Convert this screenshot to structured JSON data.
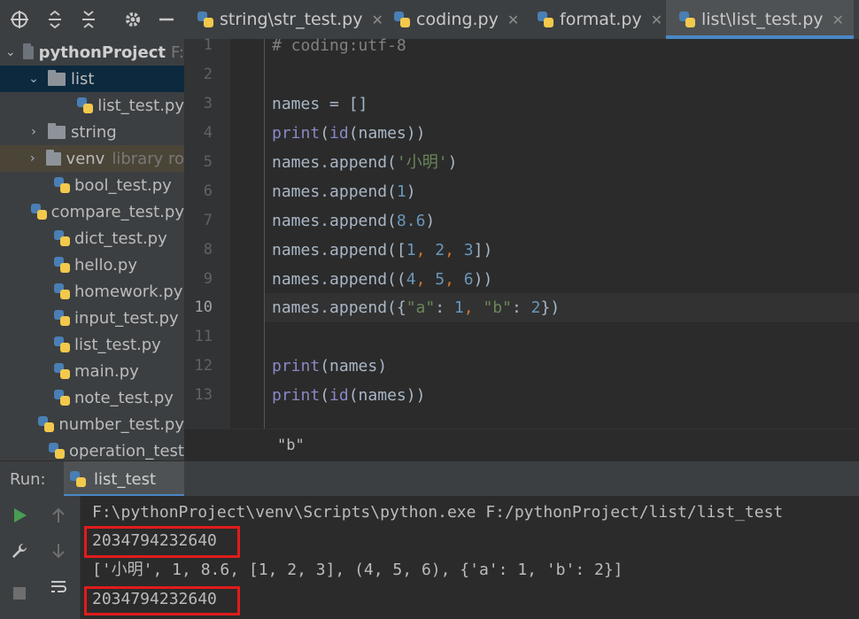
{
  "tabs": [
    {
      "label": "string\\str_test.py",
      "active": false
    },
    {
      "label": "coding.py",
      "active": false
    },
    {
      "label": "format.py",
      "active": false
    },
    {
      "label": "list\\list_test.py",
      "active": true
    }
  ],
  "tab_close": "✕",
  "project": {
    "root": "pythonProject",
    "root_hint": "F:",
    "items": [
      {
        "label": "list"
      },
      {
        "label": "list_test.py"
      },
      {
        "label": "string"
      },
      {
        "label": "venv",
        "hint": "library ro"
      },
      {
        "label": "bool_test.py"
      },
      {
        "label": "compare_test.py"
      },
      {
        "label": "dict_test.py"
      },
      {
        "label": "hello.py"
      },
      {
        "label": "homework.py"
      },
      {
        "label": "input_test.py"
      },
      {
        "label": "list_test.py"
      },
      {
        "label": "main.py"
      },
      {
        "label": "note_test.py"
      },
      {
        "label": "number_test.py"
      },
      {
        "label": "operation_test"
      }
    ]
  },
  "editor": {
    "line_numbers": [
      "1",
      "2",
      "3",
      "4",
      "5",
      "6",
      "7",
      "8",
      "9",
      "10",
      "11",
      "12",
      "13"
    ],
    "current_line": "10",
    "breadcrumb": "\"b\""
  },
  "run": {
    "label": "Run:",
    "tab_label": "list_test",
    "output": [
      "F:\\pythonProject\\venv\\Scripts\\python.exe F:/pythonProject/list/list_test",
      "2034794232640",
      "['小明', 1, 8.6, [1, 2, 3], (4, 5, 6), {'a': 1, 'b': 2}]",
      "2034794232640"
    ]
  },
  "colors": {
    "highlight_box": "#e11b1b",
    "active_tab_underline": "#4a88c7",
    "selection": "#0d293e"
  }
}
